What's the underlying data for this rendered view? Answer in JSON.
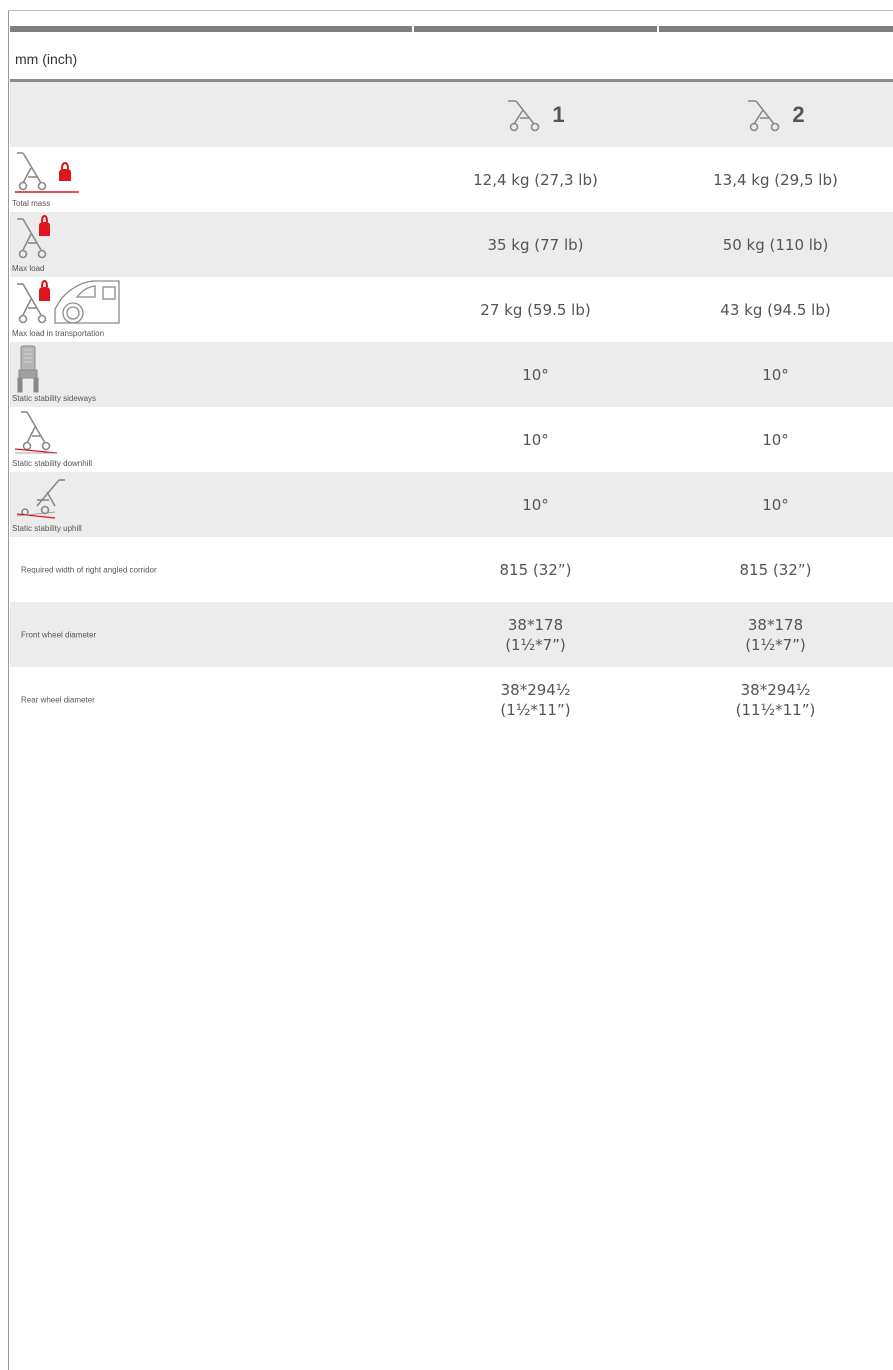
{
  "unit_label": "mm (inch)",
  "header": {
    "columns": [
      {
        "number": "1",
        "icon": "stroller-icon"
      },
      {
        "number": "2",
        "icon": "stroller-icon"
      }
    ]
  },
  "rows": [
    {
      "label": "Total mass",
      "icon": "stroller-weight-icon",
      "values": [
        [
          "12,4 kg (27,3 lb)"
        ],
        [
          "13,4 kg (29,5 lb)"
        ]
      ]
    },
    {
      "label": "Max load",
      "icon": "stroller-load-icon",
      "values": [
        [
          "35 kg (77 lb)"
        ],
        [
          "50 kg (110 lb)"
        ]
      ]
    },
    {
      "label": "Max load in transportation",
      "icon": "stroller-car-load-icon",
      "values": [
        [
          "27 kg (59.5 lb)"
        ],
        [
          "43 kg (94.5 lb)"
        ]
      ]
    },
    {
      "label": "Static stability sideways",
      "icon": "stroller-front-icon",
      "values": [
        [
          "10°"
        ],
        [
          "10°"
        ]
      ]
    },
    {
      "label": "Static stability downhill",
      "icon": "stroller-downhill-icon",
      "values": [
        [
          "10°"
        ],
        [
          "10°"
        ]
      ]
    },
    {
      "label": "Static stability uphill",
      "icon": "stroller-uphill-icon",
      "values": [
        [
          "10°"
        ],
        [
          "10°"
        ]
      ]
    },
    {
      "label": "Required width of right angled corridor",
      "icon": "",
      "values": [
        [
          "815 (32”)"
        ],
        [
          "815 (32”)"
        ]
      ]
    },
    {
      "label": "Front wheel  diameter",
      "icon": "",
      "values": [
        [
          "38*178",
          "(1½*7”)"
        ],
        [
          "38*178",
          "(1½*7”)"
        ]
      ]
    },
    {
      "label": "Rear wheel  diameter",
      "icon": "",
      "values": [
        [
          "38*294½",
          "(1½*11”)"
        ],
        [
          "38*294½",
          "(11½*11”)"
        ]
      ]
    }
  ],
  "colors": {
    "accent": "#e0141e",
    "icon_gray": "#8a8a8a",
    "row_shade": "#ececec"
  }
}
